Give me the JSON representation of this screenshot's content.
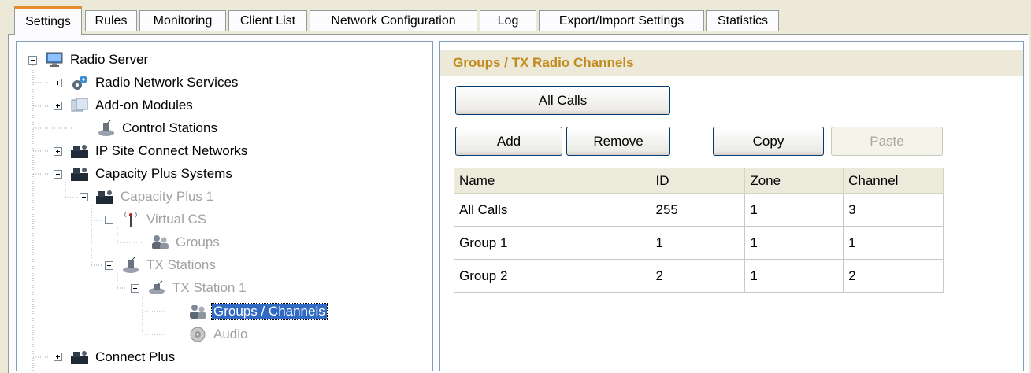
{
  "tabs": [
    {
      "label": "Settings"
    },
    {
      "label": "Rules"
    },
    {
      "label": "Monitoring"
    },
    {
      "label": "Client List"
    },
    {
      "label": "Network Configuration"
    },
    {
      "label": "Log"
    },
    {
      "label": "Export/Import Settings"
    },
    {
      "label": "Statistics"
    }
  ],
  "tree": {
    "nodes": [
      {
        "label": "Radio Server",
        "icon": "monitor-icon"
      },
      {
        "label": "Radio Network Services",
        "icon": "gears-icon"
      },
      {
        "label": "Add-on Modules",
        "icon": "modules-icon"
      },
      {
        "label": "Control Stations",
        "icon": "radio-station-icon"
      },
      {
        "label": "IP Site Connect Networks",
        "icon": "network-icon"
      },
      {
        "label": "Capacity Plus Systems",
        "icon": "network-icon"
      },
      {
        "label": "Capacity Plus 1",
        "icon": "network-icon"
      },
      {
        "label": "Virtual CS",
        "icon": "antenna-icon"
      },
      {
        "label": "Groups",
        "icon": "group-icon"
      },
      {
        "label": "TX Stations",
        "icon": "radio-station-icon"
      },
      {
        "label": "TX Station 1",
        "icon": "radio-station-icon"
      },
      {
        "label": "Groups / Channels",
        "icon": "group-icon"
      },
      {
        "label": "Audio",
        "icon": "speaker-icon"
      },
      {
        "label": "Connect Plus",
        "icon": "network-icon"
      }
    ]
  },
  "panel": {
    "title": "Groups / TX Radio Channels",
    "all_calls_label": "All Calls",
    "add_label": "Add",
    "remove_label": "Remove",
    "copy_label": "Copy",
    "paste_label": "Paste"
  },
  "table": {
    "headers": [
      "Name",
      "ID",
      "Zone",
      "Channel"
    ],
    "rows": [
      [
        "All Calls",
        "255",
        "1",
        "3"
      ],
      [
        "Group 1",
        "1",
        "1",
        "1"
      ],
      [
        "Group 2",
        "2",
        "1",
        "2"
      ]
    ]
  }
}
